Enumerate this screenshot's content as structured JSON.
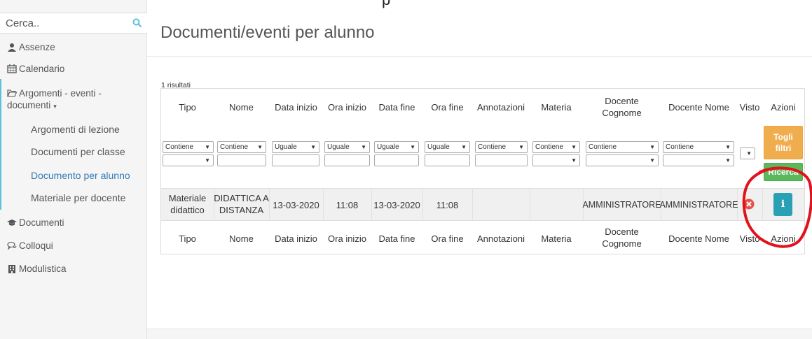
{
  "top_fragment": "p",
  "sidebar": {
    "search": {
      "placeholder": "Cerca.."
    },
    "items": [
      {
        "label": "Assenze",
        "icon": "user-icon"
      },
      {
        "label": "Calendario",
        "icon": "calendar-icon"
      },
      {
        "label": "Argomenti - eventi -",
        "label2": "documenti",
        "icon": "folder-open-icon",
        "expanded": true
      },
      {
        "label": "Documenti",
        "icon": "graduation-cap-icon"
      },
      {
        "label": "Colloqui",
        "icon": "comments-icon"
      },
      {
        "label": "Modulistica",
        "icon": "building-icon"
      }
    ],
    "subitems": [
      {
        "label": "Argomenti di lezione",
        "active": false
      },
      {
        "label": "Documenti per classe",
        "active": false
      },
      {
        "label": "Documento per alunno",
        "active": true
      },
      {
        "label": "Materiale per docente",
        "active": false
      }
    ],
    "active_color": "#337ab7",
    "accent_color": "#5bc0de"
  },
  "main": {
    "title": "Documenti/eventi per alunno",
    "results": "1 risultati",
    "columns": [
      {
        "label": "Tipo"
      },
      {
        "label": "Nome"
      },
      {
        "label": "Data inizio"
      },
      {
        "label": "Ora inizio"
      },
      {
        "label": "Data fine"
      },
      {
        "label": "Ora fine"
      },
      {
        "label": "Annotazioni"
      },
      {
        "label": "Materia"
      },
      {
        "label": "Docente",
        "label2": "Cognome"
      },
      {
        "label": "Docente Nome"
      },
      {
        "label": "Visto"
      },
      {
        "label": "Azioni"
      }
    ],
    "filters": [
      {
        "op": "Contiene"
      },
      {
        "op": "Contiene"
      },
      {
        "op": "Uguale"
      },
      {
        "op": "Uguale"
      },
      {
        "op": "Uguale"
      },
      {
        "op": "Uguale"
      },
      {
        "op": "Contiene"
      },
      {
        "op": "Contiene"
      },
      {
        "op": "Contiene"
      },
      {
        "op": "Contiene"
      }
    ],
    "togli_filtri_label": "Togli filtri",
    "ricerca_label": "Ricerca",
    "rows": [
      {
        "tipo": [
          "Materiale",
          "didattico"
        ],
        "nome": [
          "DIDATTICA A",
          "DISTANZA"
        ],
        "data_inizio": "13-03-2020",
        "ora_inizio": "11:08",
        "data_fine": "13-03-2020",
        "ora_fine": "11:08",
        "annotazioni": "",
        "materia": "",
        "docente_cognome": "AMMINISTRATORE",
        "docente_nome": "AMMINISTRATORE",
        "visto_icon": "x-circle-icon",
        "azioni_icon": "info-icon"
      }
    ],
    "colors": {
      "warning": "#f0ad4e",
      "success": "#5cb85c",
      "info": "#2aa0b4",
      "danger": "#e5534b"
    }
  }
}
